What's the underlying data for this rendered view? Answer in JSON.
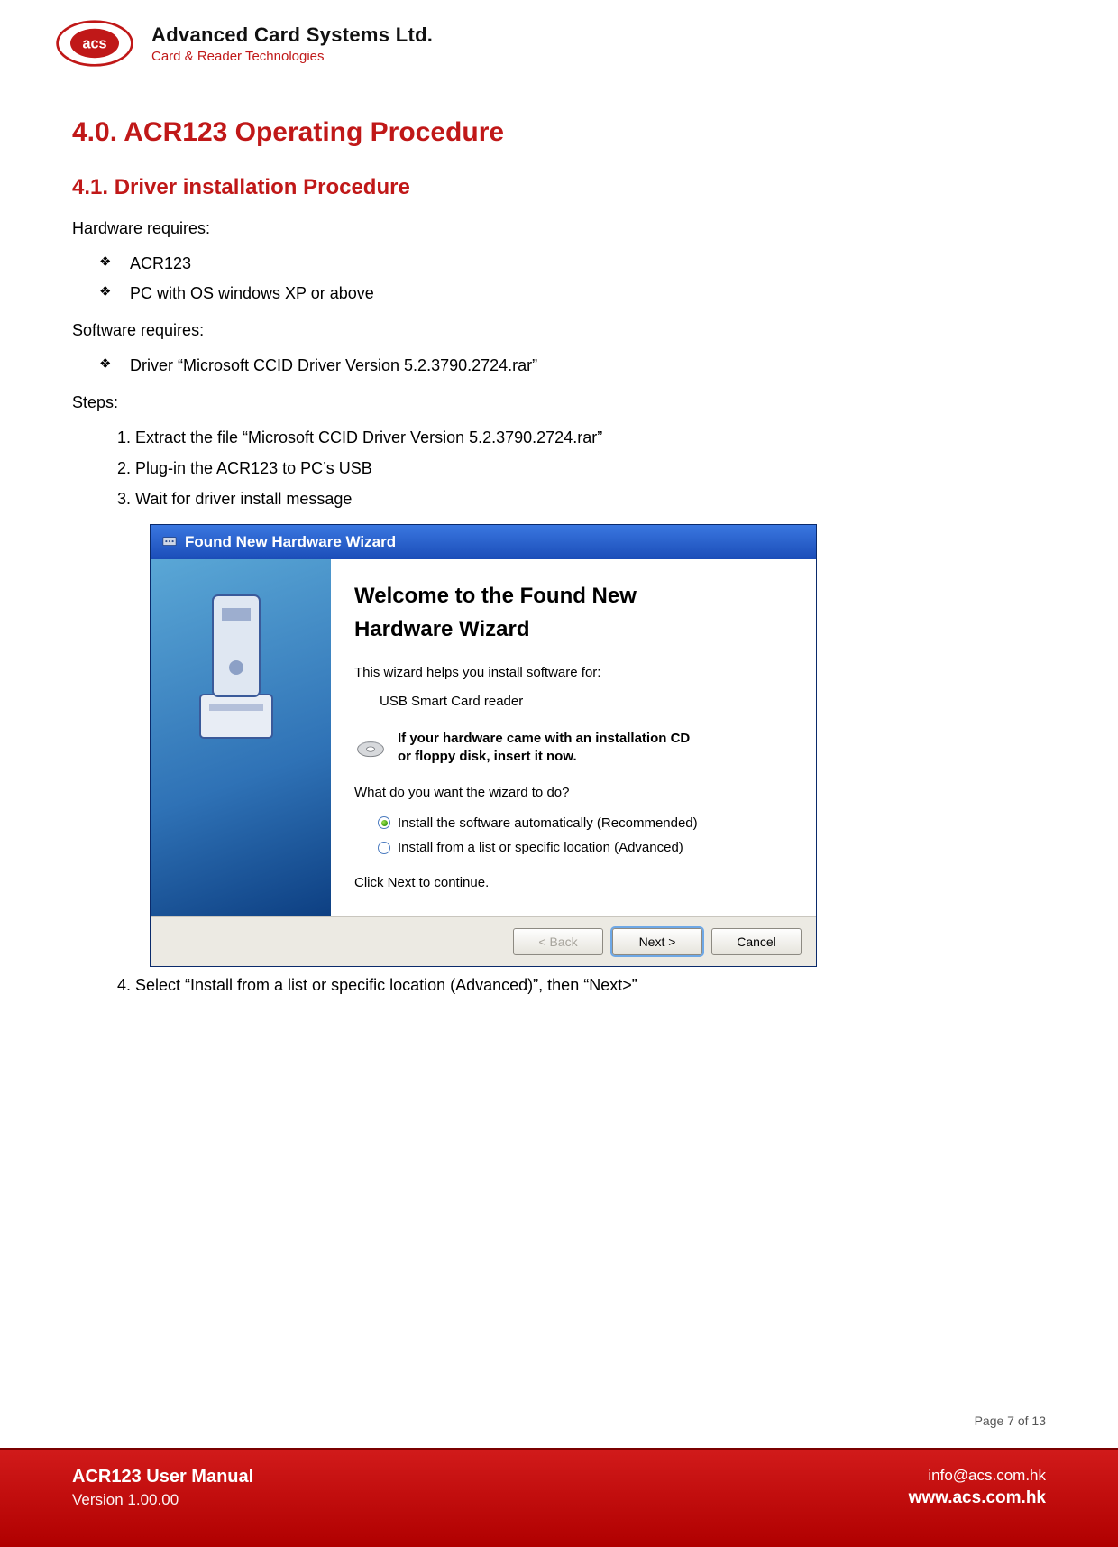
{
  "header": {
    "company_name": "Advanced Card Systems Ltd.",
    "tagline": "Card & Reader Technologies",
    "logo_text": "acs"
  },
  "section": {
    "h1": "4.0. ACR123 Operating Procedure",
    "h2": "4.1.   Driver installation Procedure",
    "hw_label": "Hardware requires:",
    "hw_items": [
      "ACR123",
      "PC with OS windows XP or above"
    ],
    "sw_label": "Software requires:",
    "sw_items": [
      "Driver “Microsoft CCID Driver Version 5.2.3790.2724.rar”"
    ],
    "steps_label": "Steps:",
    "steps": [
      "Extract the file “Microsoft CCID Driver Version 5.2.3790.2724.rar”",
      "Plug-in the ACR123 to PC’s USB",
      "Wait for driver install message",
      "Select “Install from a list or specific location (Advanced)”, then “Next>”"
    ]
  },
  "wizard": {
    "titlebar": "Found New Hardware Wizard",
    "heading_l1": "Welcome to the Found New",
    "heading_l2": "Hardware Wizard",
    "intro": "This wizard helps you install software for:",
    "device": "USB Smart Card reader",
    "cd_text_l1": "If your hardware came with an installation CD",
    "cd_text_l2": "or floppy disk, insert it now.",
    "question": "What do you want the wizard to do?",
    "radio1": "Install the software automatically (Recommended)",
    "radio2": "Install from a list or specific location (Advanced)",
    "continue": "Click Next to continue.",
    "btn_back": "< Back",
    "btn_next": "Next >",
    "btn_cancel": "Cancel"
  },
  "page_num": "Page 7 of 13",
  "footer": {
    "doc_name": "ACR123 User Manual",
    "doc_version": "Version 1.00.00",
    "email": "info@acs.com.hk",
    "site": "www.acs.com.hk"
  }
}
